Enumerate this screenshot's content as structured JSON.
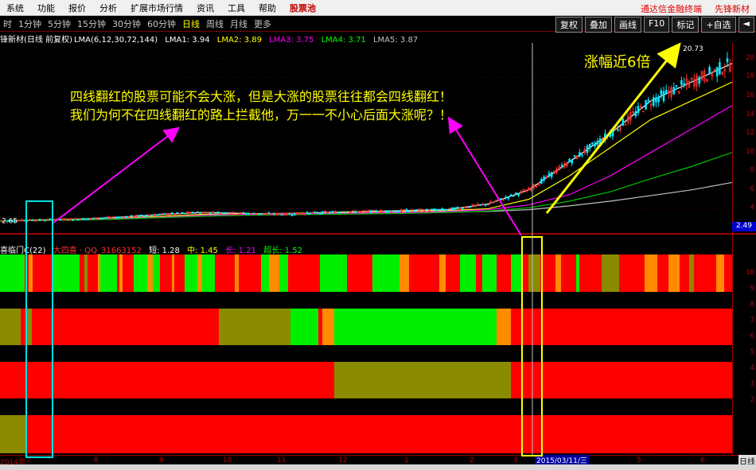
{
  "menubar": {
    "items": [
      "系统",
      "功能",
      "报价",
      "分析",
      "扩展市场行情",
      "资讯",
      "工具",
      "帮助"
    ],
    "stock_pool": "股票池",
    "right_links": [
      "通达信金融终端",
      "先锋新材"
    ]
  },
  "period_bar": {
    "items": [
      "时",
      "1分钟",
      "5分钟",
      "15分钟",
      "30分钟",
      "60分钟",
      "日线",
      "周线",
      "月线",
      "更多"
    ],
    "active": "日线",
    "tools": [
      "复权",
      "叠加",
      "画线",
      "F10",
      "标记",
      "+自选",
      "◄"
    ]
  },
  "title_line": {
    "stock": "锋新材(日线 前复权)",
    "params": "LMA(6,12,30,72,144)",
    "lma1": "LMA1: 3.94",
    "lma2": "LMA2: 3.89",
    "lma3": "LMA3: 3.75",
    "lma4": "LMA4: 3.71",
    "lma5": "LMA5: 3.87",
    "colors": {
      "lma1": "#ffffff",
      "lma2": "#ffff00",
      "lma3": "#ff00ff",
      "lma4": "#00ff00",
      "lma5": "#c0c0c0"
    }
  },
  "indicator_line": {
    "name": "喜临门C(22)",
    "author": "大四喜 · QQ_31663152",
    "short": "短: 1.28",
    "mid": "中: 1.45",
    "long": "长: 1.21",
    "super": "超长: 1.52"
  },
  "price_axis": {
    "labels": [
      "20",
      "18",
      "16",
      "14",
      "12",
      "10",
      "8",
      "6",
      "4"
    ],
    "current": "2.49",
    "high_marker": "20.73",
    "low_marker": "2.65"
  },
  "indicator_axis": {
    "labels": [
      "10",
      "9",
      "8",
      "7",
      "6",
      "5",
      "4",
      "3",
      "2"
    ]
  },
  "date_axis": {
    "labels": [
      "2014年",
      "7",
      "8",
      "9",
      "10",
      "11",
      "12",
      "1",
      "2",
      "3",
      "4",
      "5",
      "6"
    ],
    "crosshair_date": "2015/03/11/三",
    "right_tab": "日线"
  },
  "annotations": {
    "line1": "四线翻红的股票可能不会大涨，但是大涨的股票往往都会四线翻红！",
    "line2": "我们为何不在四线翻红的路上拦截他，万一一不小心后面大涨呢？！",
    "gain": "涨幅近6倍"
  },
  "chart_data": {
    "type": "heatmap",
    "price_range": [
      2,
      21
    ],
    "price_series_approx": [
      {
        "name": "LMA1",
        "values": [
          2.7,
          2.8,
          2.9,
          3.1,
          3.4,
          3.6,
          3.5,
          3.4,
          3.6,
          3.7,
          3.8,
          3.9,
          4.5,
          6.0,
          9.0,
          12.0,
          15.5,
          17.5,
          19.5
        ]
      },
      {
        "name": "LMA5",
        "values": [
          2.7,
          2.75,
          2.8,
          2.9,
          3.1,
          3.3,
          3.4,
          3.45,
          3.5,
          3.55,
          3.6,
          3.65,
          3.7,
          3.9,
          4.3,
          4.8,
          5.4,
          6.0,
          6.8
        ]
      }
    ],
    "bands_colors": {
      "green": "#00ee00",
      "red": "#ff0000",
      "olive": "#8b8b00",
      "orange": "#ff8c00"
    },
    "bands": [
      {
        "name": "短",
        "segments": [
          [
            "G",
            0,
            31
          ],
          [
            "R",
            31,
            36
          ],
          [
            "O",
            36,
            41
          ],
          [
            "R",
            41,
            67
          ],
          [
            "G",
            67,
            100
          ],
          [
            "R",
            100,
            106
          ],
          [
            "O",
            106,
            110
          ],
          [
            "R",
            110,
            123
          ],
          [
            "O",
            123,
            126
          ],
          [
            "G",
            126,
            147
          ],
          [
            "R",
            147,
            150
          ],
          [
            "O",
            150,
            154
          ],
          [
            "R",
            154,
            168
          ],
          [
            "G",
            168,
            185
          ],
          [
            "O",
            185,
            192
          ],
          [
            "G",
            192,
            201
          ],
          [
            "R",
            201,
            216
          ],
          [
            "O",
            216,
            219
          ],
          [
            "R",
            219,
            232
          ],
          [
            "G",
            232,
            248
          ],
          [
            "O",
            248,
            254
          ],
          [
            "G",
            254,
            270
          ],
          [
            "R",
            270,
            295
          ],
          [
            "O",
            295,
            300
          ],
          [
            "R",
            300,
            328
          ],
          [
            "G",
            328,
            338
          ],
          [
            "O",
            338,
            351
          ],
          [
            "G",
            351,
            362
          ],
          [
            "R",
            362,
            402
          ],
          [
            "G",
            402,
            436
          ],
          [
            "R",
            436,
            468
          ],
          [
            "G",
            468,
            502
          ],
          [
            "O",
            502,
            514
          ],
          [
            "R",
            514,
            552
          ],
          [
            "O",
            552,
            560
          ],
          [
            "R",
            560,
            578
          ],
          [
            "G",
            578,
            598
          ],
          [
            "R",
            598,
            606
          ],
          [
            "G",
            606,
            624
          ],
          [
            "R",
            624,
            642
          ],
          [
            "G",
            642,
            656
          ],
          [
            "R",
            656,
            664
          ],
          [
            "O",
            664,
            679
          ],
          [
            "R",
            679,
            698
          ],
          [
            "O",
            698,
            705
          ],
          [
            "R",
            705,
            724
          ],
          [
            "G",
            724,
            728
          ],
          [
            "R",
            728,
            756
          ],
          [
            "O",
            756,
            778
          ],
          [
            "R",
            778,
            810
          ],
          [
            "O",
            810,
            826
          ],
          [
            "R",
            826,
            840
          ],
          [
            "O",
            840,
            854
          ],
          [
            "R",
            854,
            866
          ],
          [
            "O",
            866,
            872
          ],
          [
            "R",
            872,
            900
          ],
          [
            "O",
            900,
            910
          ],
          [
            "R",
            910,
            920
          ]
        ]
      },
      {
        "name": "中",
        "segments": [
          [
            "O",
            0,
            26
          ],
          [
            "R",
            26,
            32
          ],
          [
            "O",
            32,
            40
          ],
          [
            "R",
            40,
            275
          ],
          [
            "O",
            275,
            287
          ],
          [
            "O",
            287,
            365
          ],
          [
            "G",
            365,
            400
          ],
          [
            "R",
            400,
            405
          ],
          [
            "O",
            405,
            420
          ],
          [
            "G",
            420,
            624
          ],
          [
            "O",
            624,
            642
          ],
          [
            "R",
            642,
            920
          ]
        ]
      },
      {
        "name": "长",
        "segments": [
          [
            "R",
            0,
            420
          ],
          [
            "O",
            420,
            642
          ],
          [
            "R",
            642,
            920
          ]
        ]
      },
      {
        "name": "超长",
        "segments": [
          [
            "O",
            0,
            32
          ],
          [
            "R",
            32,
            920
          ]
        ]
      }
    ]
  }
}
